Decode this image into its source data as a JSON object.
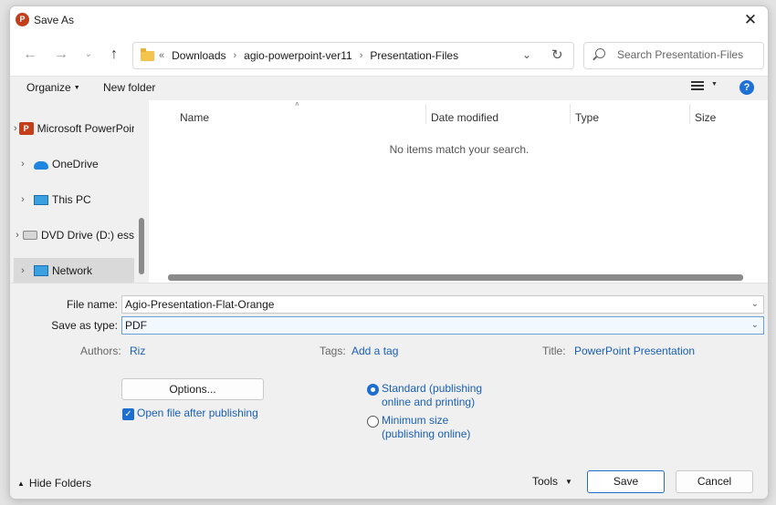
{
  "window": {
    "title": "Save As",
    "app_icon_letter": "P"
  },
  "nav": {
    "back_icon": "arrow-left-icon",
    "forward_icon": "arrow-right-icon",
    "recent_icon": "chevron-down-icon",
    "up_icon": "arrow-up-icon",
    "breadcrumb": [
      "Downloads",
      "agio-powerpoint-ver11",
      "Presentation-Files"
    ],
    "breadcrumb_lead": "«"
  },
  "search": {
    "placeholder": "Search Presentation-Files"
  },
  "toolbar": {
    "organize_label": "Organize",
    "new_folder_label": "New folder",
    "help_label": "?"
  },
  "sidebar": {
    "items": [
      {
        "label": "Microsoft PowerPoint",
        "icon": "powerpoint-icon"
      },
      {
        "label": "OneDrive",
        "icon": "onedrive-icon"
      },
      {
        "label": "This PC",
        "icon": "this-pc-icon"
      },
      {
        "label": "DVD Drive (D:) ess",
        "icon": "dvd-drive-icon"
      },
      {
        "label": "Network",
        "icon": "network-icon",
        "selected": true
      }
    ]
  },
  "filelist": {
    "columns": [
      "Name",
      "Date modified",
      "Type",
      "Size"
    ],
    "sort_indicator": "˄",
    "empty_message": "No items match your search."
  },
  "form": {
    "file_name_label": "File name:",
    "file_name_value": "Agio-Presentation-Flat-Orange",
    "save_type_label": "Save as type:",
    "save_type_value": "PDF",
    "authors_label": "Authors:",
    "authors_value": "Riz",
    "tags_label": "Tags:",
    "tags_value": "Add a tag",
    "title_label": "Title:",
    "title_value": "PowerPoint Presentation",
    "options_label": "Options...",
    "open_after_label": "Open file after publishing",
    "open_after_checked": true,
    "radio_standard_line1": "Standard (publishing",
    "radio_standard_line2": "online and printing)",
    "radio_minimum_line1": "Minimum size",
    "radio_minimum_line2": "(publishing online)",
    "selected_optimization": "standard"
  },
  "footer": {
    "hide_folders_label": "Hide Folders",
    "tools_label": "Tools",
    "save_label": "Save",
    "cancel_label": "Cancel"
  },
  "colors": {
    "accent": "#1c6fce",
    "link": "#1a5fb4",
    "ppt": "#c43e1c"
  }
}
